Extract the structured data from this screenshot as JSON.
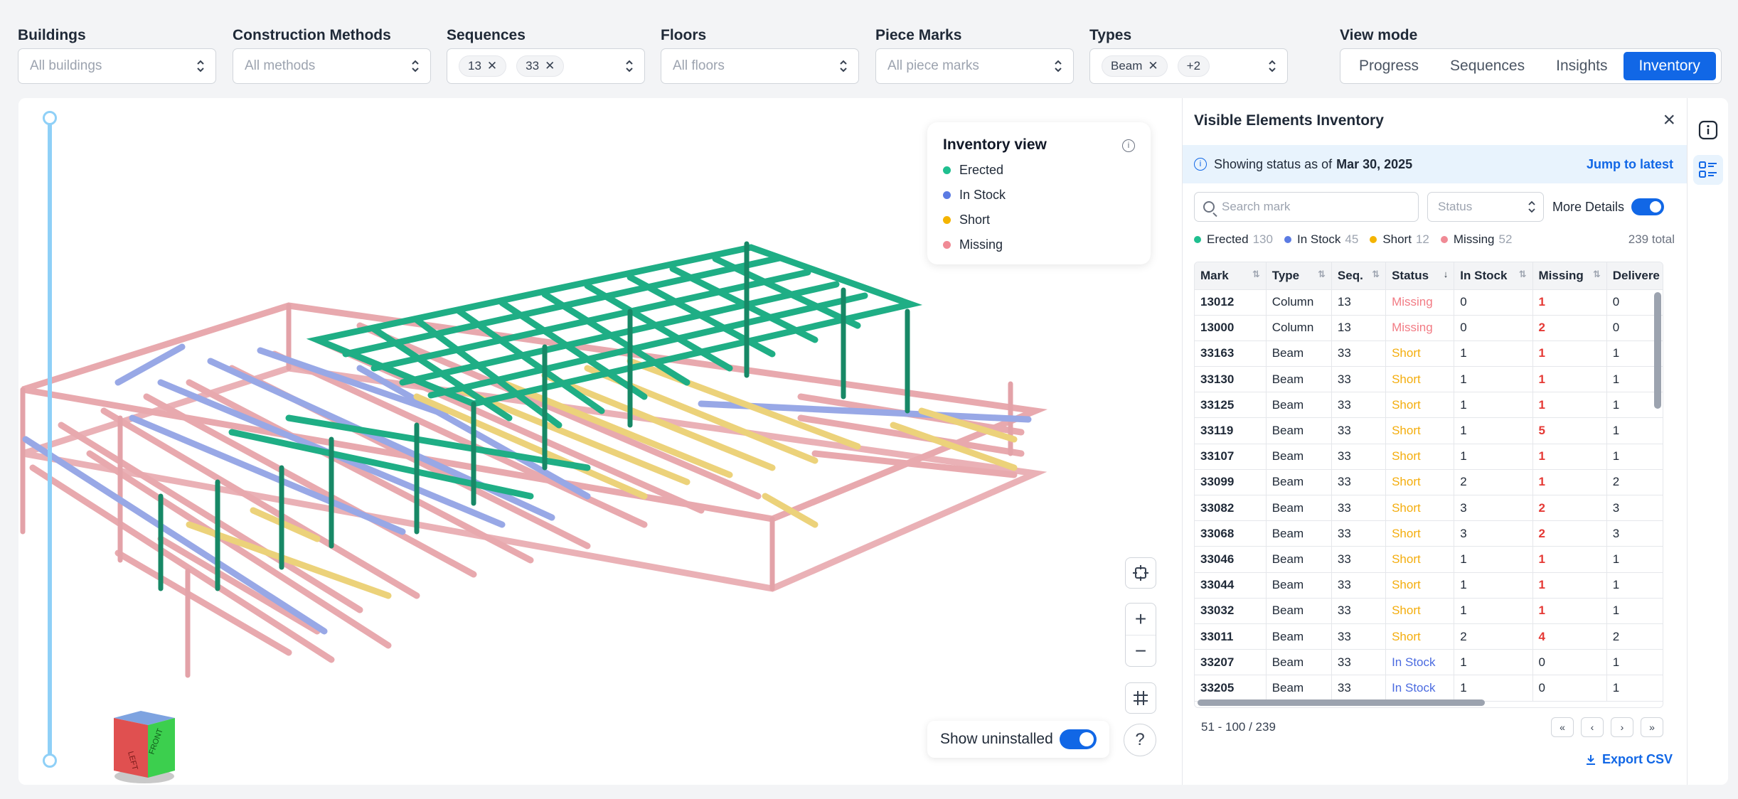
{
  "filters": {
    "buildings": {
      "label": "Buildings",
      "placeholder": "All buildings"
    },
    "methods": {
      "label": "Construction Methods",
      "placeholder": "All methods"
    },
    "sequences": {
      "label": "Sequences",
      "chips": [
        "13",
        "33"
      ]
    },
    "floors": {
      "label": "Floors",
      "placeholder": "All floors"
    },
    "piece_marks": {
      "label": "Piece Marks",
      "placeholder": "All piece marks"
    },
    "types": {
      "label": "Types",
      "chips": [
        "Beam"
      ],
      "more": "+2"
    }
  },
  "view_mode": {
    "label": "View mode",
    "tabs": [
      "Progress",
      "Sequences",
      "Insights",
      "Inventory"
    ],
    "active": "Inventory"
  },
  "legend": {
    "title": "Inventory view",
    "items": [
      {
        "label": "Erected",
        "color": "#1fbf8f"
      },
      {
        "label": "In Stock",
        "color": "#5b7be3"
      },
      {
        "label": "Short",
        "color": "#f4b400"
      },
      {
        "label": "Missing",
        "color": "#f08a95"
      }
    ]
  },
  "viewer": {
    "show_uninstalled": "Show uninstalled",
    "zoom_in": "+",
    "zoom_out": "−",
    "help": "?",
    "cube_left": "LEFT",
    "cube_front": "FRONT"
  },
  "panel": {
    "title": "Visible Elements Inventory",
    "status_prefix": "Showing status as of",
    "status_date": "Mar 30, 2025",
    "jump": "Jump to latest",
    "search_placeholder": "Search mark",
    "status_placeholder": "Status",
    "more_details": "More Details",
    "counts": [
      {
        "label": "Erected",
        "value": "130",
        "color": "#1fbf8f"
      },
      {
        "label": "In Stock",
        "value": "45",
        "color": "#5b7be3"
      },
      {
        "label": "Short",
        "value": "12",
        "color": "#f4b400"
      },
      {
        "label": "Missing",
        "value": "52",
        "color": "#f08a95"
      }
    ],
    "total": "239 total",
    "columns": [
      "Mark",
      "Type",
      "Seq.",
      "Status",
      "In Stock",
      "Missing",
      "Delivere"
    ],
    "rows": [
      [
        "13012",
        "Column",
        "13",
        "Missing",
        "0",
        "1",
        "0"
      ],
      [
        "13000",
        "Column",
        "13",
        "Missing",
        "0",
        "2",
        "0"
      ],
      [
        "33163",
        "Beam",
        "33",
        "Short",
        "1",
        "1",
        "1"
      ],
      [
        "33130",
        "Beam",
        "33",
        "Short",
        "1",
        "1",
        "1"
      ],
      [
        "33125",
        "Beam",
        "33",
        "Short",
        "1",
        "1",
        "1"
      ],
      [
        "33119",
        "Beam",
        "33",
        "Short",
        "1",
        "5",
        "1"
      ],
      [
        "33107",
        "Beam",
        "33",
        "Short",
        "1",
        "1",
        "1"
      ],
      [
        "33099",
        "Beam",
        "33",
        "Short",
        "2",
        "1",
        "2"
      ],
      [
        "33082",
        "Beam",
        "33",
        "Short",
        "3",
        "2",
        "3"
      ],
      [
        "33068",
        "Beam",
        "33",
        "Short",
        "3",
        "2",
        "3"
      ],
      [
        "33046",
        "Beam",
        "33",
        "Short",
        "1",
        "1",
        "1"
      ],
      [
        "33044",
        "Beam",
        "33",
        "Short",
        "1",
        "1",
        "1"
      ],
      [
        "33032",
        "Beam",
        "33",
        "Short",
        "1",
        "1",
        "1"
      ],
      [
        "33011",
        "Beam",
        "33",
        "Short",
        "2",
        "4",
        "2"
      ],
      [
        "33207",
        "Beam",
        "33",
        "In Stock",
        "1",
        "0",
        "1"
      ],
      [
        "33205",
        "Beam",
        "33",
        "In Stock",
        "1",
        "0",
        "1"
      ]
    ],
    "pagination": "51 - 100 / 239",
    "export": "Export CSV"
  }
}
